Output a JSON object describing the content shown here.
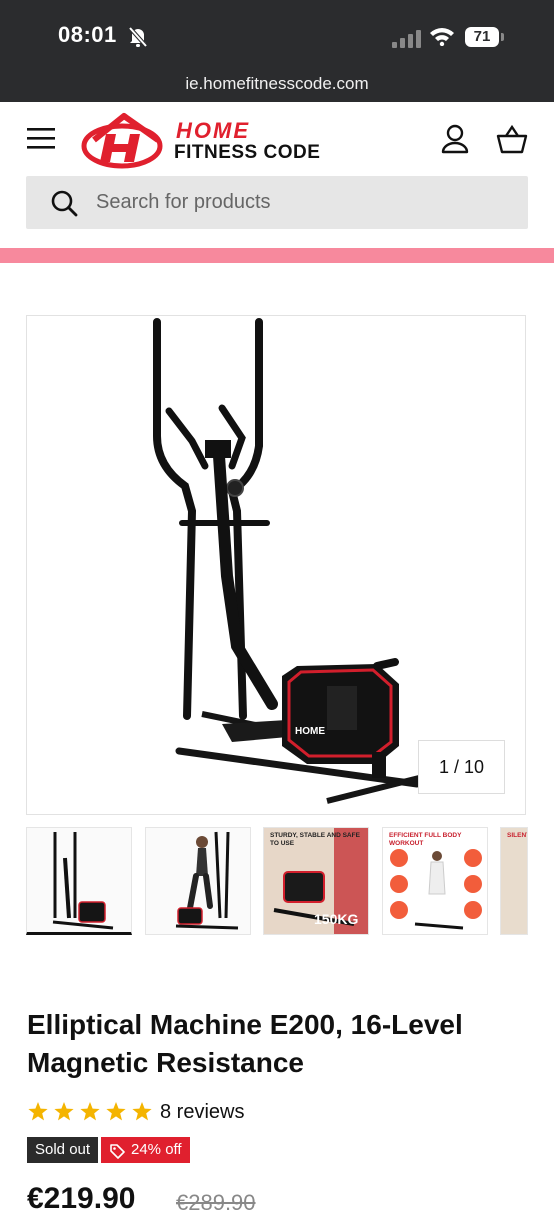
{
  "status_bar": {
    "time": "08:01",
    "battery": "71",
    "url": "ie.homefitnesscode.com"
  },
  "header": {
    "logo_line1": "HOME",
    "logo_line2": "FITNESS CODE"
  },
  "search": {
    "placeholder": "Search for products"
  },
  "gallery": {
    "counter": "1 / 10",
    "thumbnails": [
      {
        "caption": ""
      },
      {
        "caption": ""
      },
      {
        "caption": "STURDY, STABLE AND SAFE TO USE"
      },
      {
        "caption": "EFFICIENT FULL BODY WORKOUT"
      },
      {
        "caption": "SILENT"
      }
    ],
    "weight_label": "150KG"
  },
  "product": {
    "title": "Elliptical Machine E200, 16-Level Magnetic Resistance",
    "rating": 5,
    "reviews": "8 reviews",
    "badge_sold_out": "Sold out",
    "badge_discount": "24% off",
    "price": "€219.90",
    "compare_price": "€289.90"
  },
  "colors": {
    "brand_red": "#e0202e",
    "pink_bar": "#f7899d",
    "status_bg": "#2b2c2e",
    "star": "#f4b400"
  },
  "icons": [
    "bell-slash-icon",
    "signal-icon",
    "wifi-icon",
    "battery-icon",
    "menu-icon",
    "account-icon",
    "cart-icon",
    "search-icon",
    "star-icon",
    "tag-icon"
  ]
}
